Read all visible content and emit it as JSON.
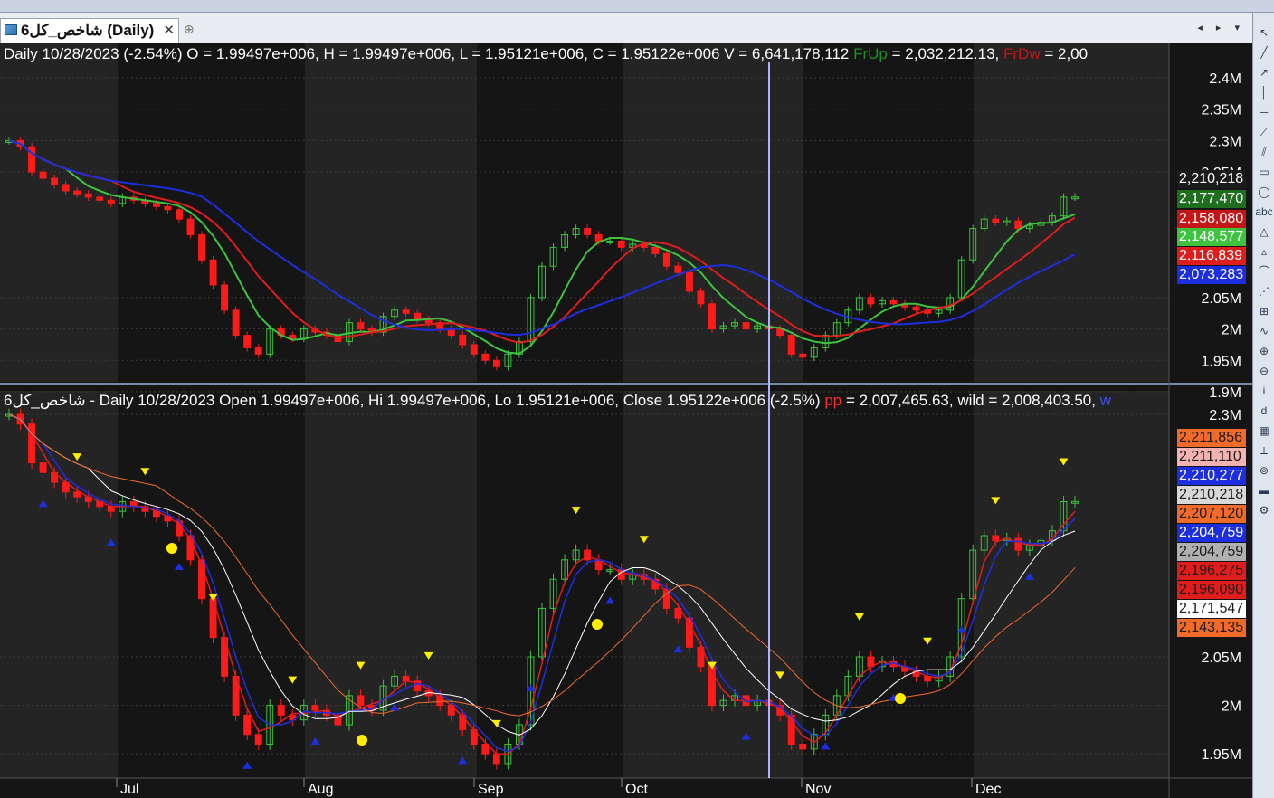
{
  "tab": {
    "title": "شاخص_کل6 (Daily)",
    "close_glyph": "✕",
    "new_glyph": "⊕",
    "nav": "◂ ▸ ▾"
  },
  "pane1": {
    "header": {
      "interval": "Daily 10/28/2023",
      "change": "(-2.54%)",
      "ohlcv": "O = 1.99497e+006, H = 1.99497e+006, L = 1.95121e+006, C = 1.95122e+006  V = 6,641,178,112",
      "fr_up_name": "FrUp",
      "fr_up_value": "= 2,032,212.13,",
      "fr_dw_name": "FrDw",
      "fr_dw_value": "= 2,00"
    },
    "axis_labels": [
      {
        "label": "2.4M",
        "value": 2400000
      },
      {
        "label": "2.35M",
        "value": 2350000
      },
      {
        "label": "2.3M",
        "value": 2300000
      },
      {
        "label": "2.25M",
        "value": 2250000
      },
      {
        "label": "2.05M",
        "value": 2050000
      },
      {
        "label": "2M",
        "value": 2000000
      },
      {
        "label": "1.95M",
        "value": 1950000
      },
      {
        "label": "1.9M",
        "value": 1900000
      }
    ],
    "value_tags": [
      {
        "text": "2,210,218",
        "bg": "#1b1b1b",
        "fg": "#ffffff",
        "value": 2210218
      },
      {
        "text": "2,177,470",
        "bg": "#1f6e1f",
        "fg": "#ffffff",
        "value": 2177470
      },
      {
        "text": "2,158,080",
        "bg": "#c41616",
        "fg": "#ffffff",
        "value": 2158080
      },
      {
        "text": "2,148,577",
        "bg": "#3fc23f",
        "fg": "#ffffff",
        "value": 2148577
      },
      {
        "text": "2,116,839",
        "bg": "#e01d1d",
        "fg": "#ffffff",
        "value": 2116839
      },
      {
        "text": "2,073,283",
        "bg": "#1d2ee0",
        "fg": "#ffffff",
        "value": 2073283
      }
    ]
  },
  "pane2": {
    "header": {
      "text": "6شاخص_کل - Daily 10/28/2023 Open 1.99497e+006, Hi 1.99497e+006, Lo 1.95121e+006, Close 1.95122e+006 (-2.5%)",
      "pp_name": "pp",
      "pp_value": "= 2,007,465.63, wild = 2,008,403.50,",
      "w_name": "w"
    },
    "axis_labels": [
      {
        "label": "2.3M",
        "value": 2300000
      },
      {
        "label": "2.05M",
        "value": 2050000
      },
      {
        "label": "2M",
        "value": 2000000
      },
      {
        "label": "1.95M",
        "value": 1950000
      }
    ],
    "value_tags": [
      {
        "text": "2,211,856",
        "bg": "#f06a2a",
        "fg": "#1b1b1b"
      },
      {
        "text": "2,211,110",
        "bg": "#f4b2b2",
        "fg": "#1b1b1b"
      },
      {
        "text": "2,210,277",
        "bg": "#1d2ee0",
        "fg": "#ffffff"
      },
      {
        "text": "2,210,218",
        "bg": "#d8d8d8",
        "fg": "#1b1b1b"
      },
      {
        "text": "2,207,120",
        "bg": "#f06a2a",
        "fg": "#1b1b1b"
      },
      {
        "text": "2,204,759",
        "bg": "#1d2ee0",
        "fg": "#ffffff"
      },
      {
        "text": "2,204,759",
        "bg": "#b0b0b0",
        "fg": "#1b1b1b"
      },
      {
        "text": "2,196,275",
        "bg": "#e01d1d",
        "fg": "#1b1b1b"
      },
      {
        "text": "2,196,090",
        "bg": "#e01d1d",
        "fg": "#1b1b1b"
      },
      {
        "text": "2,171,547",
        "bg": "#ffffff",
        "fg": "#1b1b1b"
      },
      {
        "text": "2,143,135",
        "bg": "#f06a2a",
        "fg": "#1b1b1b"
      }
    ]
  },
  "x_axis": {
    "months": [
      "Jul",
      "Aug",
      "Sep",
      "Oct",
      "Nov",
      "Dec"
    ]
  },
  "colors": {
    "up": "#3fc23f",
    "down": "#ff1a1a",
    "blue": "#1d2ee0",
    "red": "#e01d1d",
    "green": "#3fc23f",
    "orange": "#f06a2a",
    "white": "#ffffff",
    "yellow": "#ffee00",
    "cursor": "#b0b4ff",
    "shade": "#242424"
  },
  "toolbar": {
    "icons": [
      "pointer-icon",
      "line-icon",
      "ray-icon",
      "vertical-line-icon",
      "horizontal-line-icon",
      "trend-icon",
      "channel-icon",
      "rectangle-icon",
      "ellipse-icon",
      "text-icon",
      "arrow-up-icon",
      "triangle-icon",
      "arc-icon",
      "fibonacci-icon",
      "gann-icon",
      "cycle-icon",
      "zoom-in-icon",
      "zoom-out-icon",
      "info-icon",
      "draw-icon",
      "grid-icon",
      "pitchfork-icon",
      "spiral-icon",
      "ruler-icon",
      "settings-icon"
    ]
  },
  "chart_data": {
    "type": "candlestick",
    "interval": "Daily",
    "x_labels": [
      "Jul",
      "Aug",
      "Sep",
      "Oct",
      "Nov",
      "Dec"
    ],
    "series_close": [
      2300000,
      2290000,
      2250000,
      2240000,
      2230000,
      2220000,
      2215000,
      2210000,
      2205000,
      2200000,
      2210000,
      2205000,
      2200000,
      2195000,
      2190000,
      2175000,
      2150000,
      2110000,
      2070000,
      2030000,
      1990000,
      1970000,
      1960000,
      2000000,
      1990000,
      1985000,
      2000000,
      1995000,
      1990000,
      1980000,
      2010000,
      2000000,
      1995000,
      2020000,
      2030000,
      2025000,
      2015000,
      2010000,
      2000000,
      1990000,
      1975000,
      1960000,
      1950000,
      1940000,
      1960000,
      1980000,
      2050000,
      2100000,
      2130000,
      2150000,
      2160000,
      2150000,
      2140000,
      2140000,
      2130000,
      2135000,
      2130000,
      2120000,
      2100000,
      2090000,
      2060000,
      2040000,
      2000000,
      2005000,
      2010000,
      2000000,
      2005000,
      2000000,
      1990000,
      1960000,
      1955000,
      1970000,
      1990000,
      2010000,
      2030000,
      2050000,
      2040000,
      2045000,
      2040000,
      2035000,
      2030000,
      2025000,
      2030000,
      2050000,
      2110000,
      2160000,
      2175000,
      2170000,
      2172000,
      2160000,
      2165000,
      2170000,
      2180000,
      2210000,
      2210218
    ],
    "ma_blue_last": 2073283,
    "ma_red_last": 2116839,
    "ma_green_last": 2148577
  }
}
